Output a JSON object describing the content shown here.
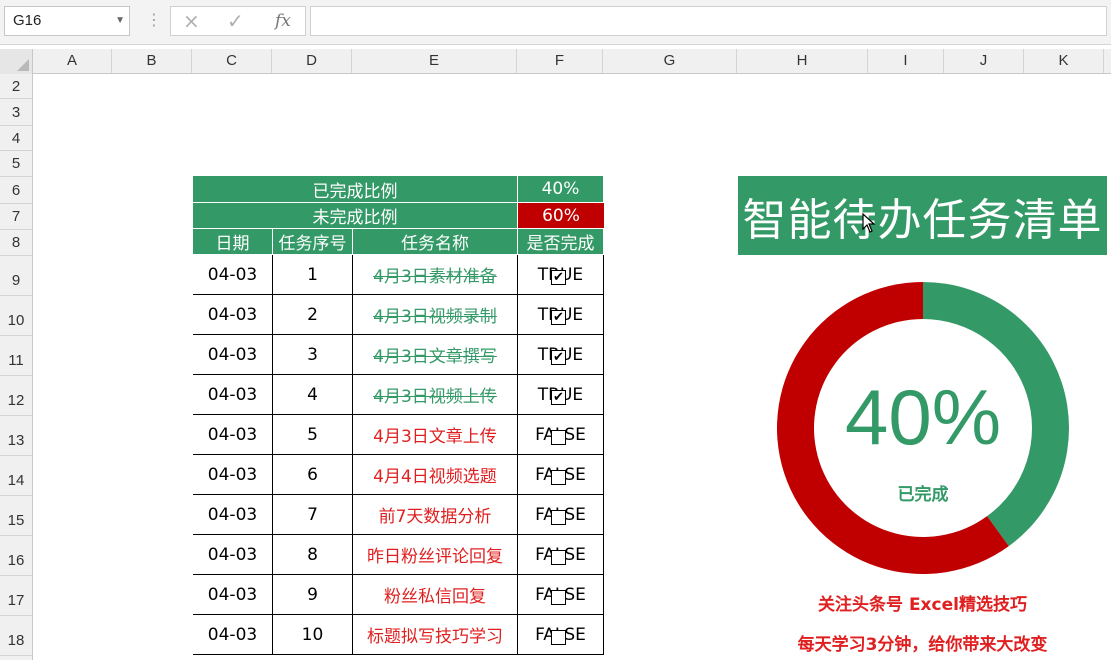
{
  "formula_bar": {
    "name_box": "G16",
    "cancel_icon": "×",
    "enter_icon": "✓",
    "fx_label": "fx",
    "formula_value": ""
  },
  "columns": [
    "A",
    "B",
    "C",
    "D",
    "E",
    "F",
    "G",
    "H",
    "I",
    "J",
    "K"
  ],
  "rows": [
    "2",
    "3",
    "4",
    "5",
    "6",
    "7",
    "8",
    "9",
    "10",
    "11",
    "12",
    "13",
    "14",
    "15",
    "16",
    "17",
    "18"
  ],
  "summary": {
    "completed_label": "已完成比例",
    "completed_value": "40%",
    "incomplete_label": "未完成比例",
    "incomplete_value": "60%"
  },
  "table": {
    "headers": [
      "日期",
      "任务序号",
      "任务名称",
      "是否完成"
    ],
    "rows": [
      {
        "date": "04-03",
        "no": "1",
        "name": "4月3日素材准备",
        "status": "TRUE",
        "done": true
      },
      {
        "date": "04-03",
        "no": "2",
        "name": "4月3日视频录制",
        "status": "TRUE",
        "done": true
      },
      {
        "date": "04-03",
        "no": "3",
        "name": "4月3日文章撰写",
        "status": "TRUE",
        "done": true
      },
      {
        "date": "04-03",
        "no": "4",
        "name": "4月3日视频上传",
        "status": "TRUE",
        "done": true
      },
      {
        "date": "04-03",
        "no": "5",
        "name": "4月3日文章上传",
        "status": "FALSE",
        "done": false
      },
      {
        "date": "04-03",
        "no": "6",
        "name": "4月4日视频选题",
        "status": "FALSE",
        "done": false
      },
      {
        "date": "04-03",
        "no": "7",
        "name": "前7天数据分析",
        "status": "FALSE",
        "done": false
      },
      {
        "date": "04-03",
        "no": "8",
        "name": "昨日粉丝评论回复",
        "status": "FALSE",
        "done": false
      },
      {
        "date": "04-03",
        "no": "9",
        "name": "粉丝私信回复",
        "status": "FALSE",
        "done": false
      },
      {
        "date": "04-03",
        "no": "10",
        "name": "标题拟写技巧学习",
        "status": "FALSE",
        "done": false
      }
    ]
  },
  "dashboard": {
    "title": "智能待办任务清单",
    "donut_completed_fraction": 0.4,
    "percent_text": "40%",
    "sub_label": "已完成",
    "note_line1": "关注头条号 Excel精选技巧",
    "note_line2": "每天学习3分钟，给你带来大改变"
  },
  "colors": {
    "green": "#339966",
    "red": "#c00000",
    "red_text": "#e02020"
  }
}
